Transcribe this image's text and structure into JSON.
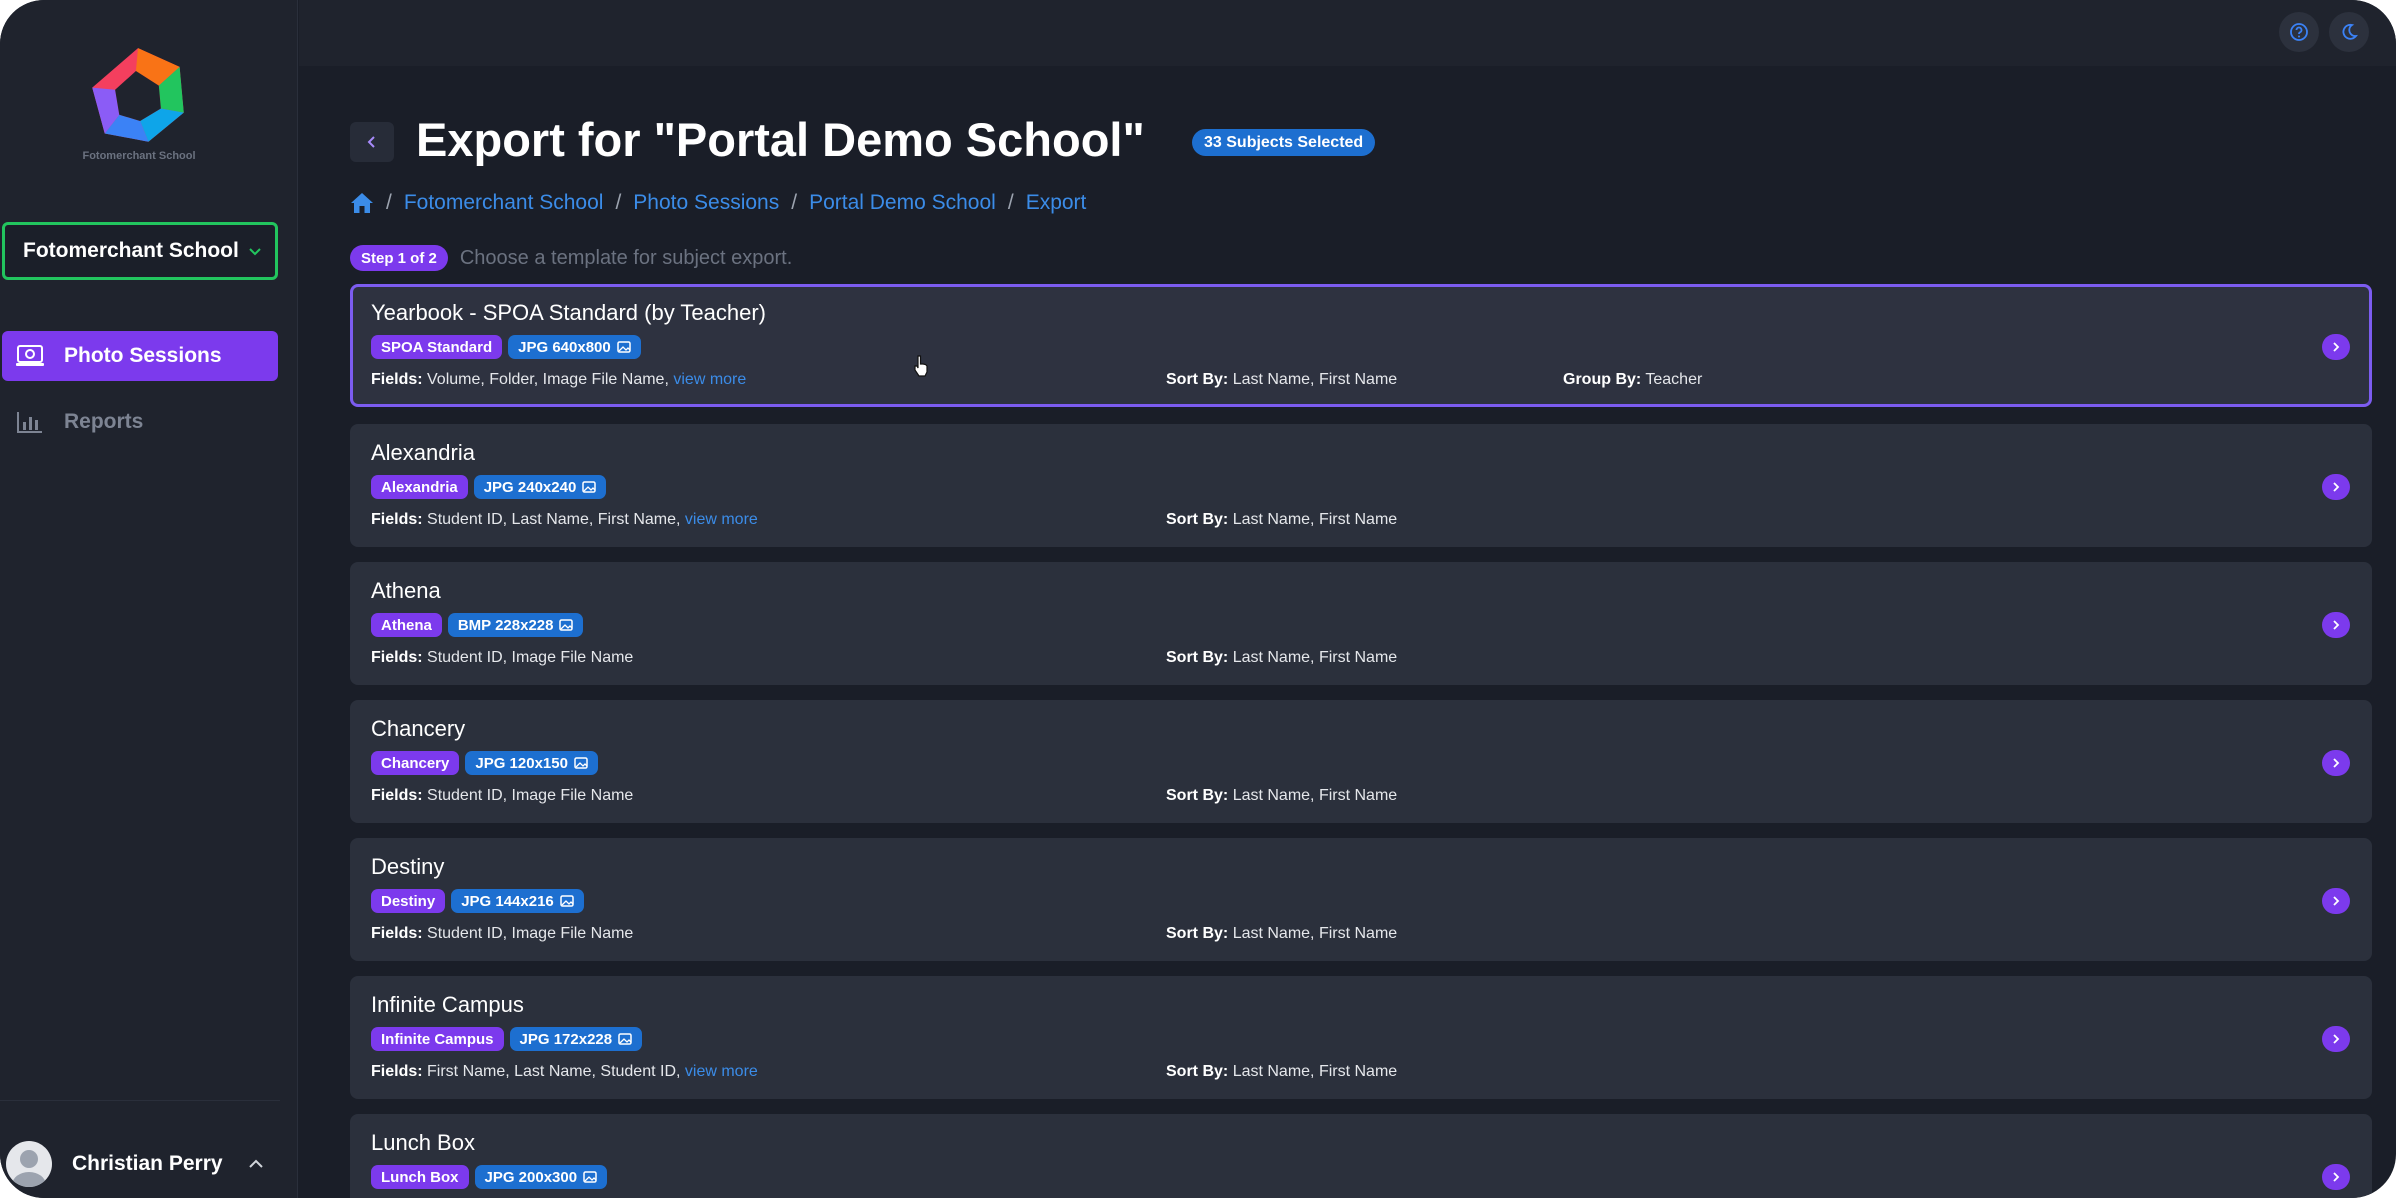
{
  "sidebar": {
    "logo_text": "Fotomerchant School",
    "school_select": "Fotomerchant School",
    "nav": [
      {
        "label": "Photo Sessions",
        "icon": "camera-monitor-icon",
        "active": true
      },
      {
        "label": "Reports",
        "icon": "bar-chart-icon",
        "active": false
      }
    ],
    "user_name": "Christian Perry"
  },
  "header": {
    "title": "Export for \"Portal Demo School\"",
    "subjects_badge": "33 Subjects Selected",
    "breadcrumb": [
      "Fotomerchant School",
      "Photo Sessions",
      "Portal Demo School",
      "Export"
    ],
    "step_badge": "Step 1 of 2",
    "step_text": "Choose a template for subject export."
  },
  "labels": {
    "fields": "Fields:",
    "sort_by": "Sort By:",
    "group_by": "Group By:",
    "view_more": "view more"
  },
  "templates": [
    {
      "name": "Yearbook - SPOA Standard (by Teacher)",
      "tag": "SPOA Standard",
      "format": "JPG 640x800",
      "fields": "Volume, Folder, Image File Name,",
      "view_more": true,
      "sort_by": "Last Name, First Name",
      "group_by": "Teacher",
      "selected": true
    },
    {
      "name": "Alexandria",
      "tag": "Alexandria",
      "format": "JPG 240x240",
      "fields": "Student ID, Last Name, First Name,",
      "view_more": true,
      "sort_by": "Last Name, First Name"
    },
    {
      "name": "Athena",
      "tag": "Athena",
      "format": "BMP 228x228",
      "fields": "Student ID, Image File Name",
      "view_more": false,
      "sort_by": "Last Name, First Name"
    },
    {
      "name": "Chancery",
      "tag": "Chancery",
      "format": "JPG 120x150",
      "fields": "Student ID, Image File Name",
      "view_more": false,
      "sort_by": "Last Name, First Name"
    },
    {
      "name": "Destiny",
      "tag": "Destiny",
      "format": "JPG 144x216",
      "fields": "Student ID, Image File Name",
      "view_more": false,
      "sort_by": "Last Name, First Name"
    },
    {
      "name": "Infinite Campus",
      "tag": "Infinite Campus",
      "format": "JPG 172x228",
      "fields": "First Name, Last Name, Student ID,",
      "view_more": true,
      "sort_by": "Last Name, First Name"
    },
    {
      "name": "Lunch Box",
      "tag": "Lunch Box",
      "format": "JPG 200x300",
      "fields": "",
      "view_more": false,
      "sort_by": ""
    }
  ],
  "colors": {
    "accent": "#7c3aed",
    "link": "#3b8ce8",
    "badge_blue": "#1d6fd0",
    "highlight_border": "#22c55e"
  }
}
